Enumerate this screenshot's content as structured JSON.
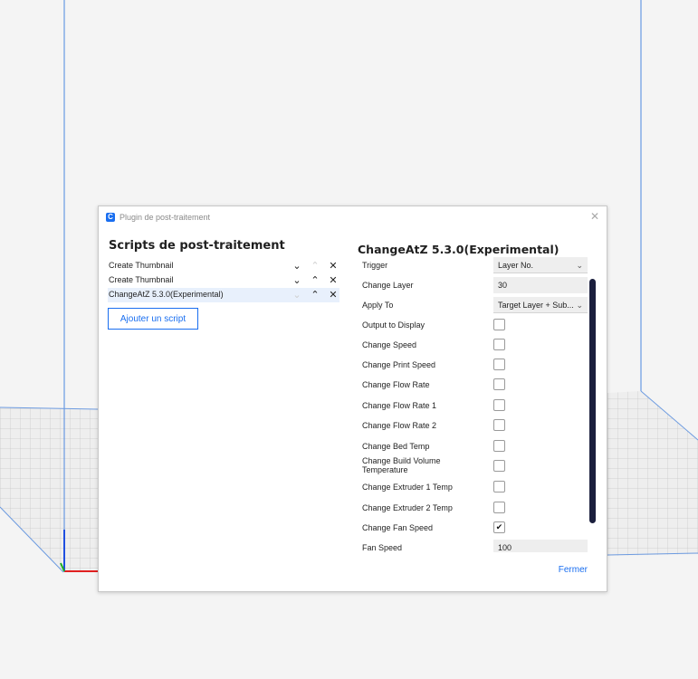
{
  "colors": {
    "accent": "#196ef0",
    "scrollbar": "#1b1f3d",
    "selected_row": "#e8f0fc"
  },
  "window": {
    "title": "Plugin de post-traitement",
    "icon": "app-icon",
    "icon_letter": "C",
    "close_icon": "close-icon"
  },
  "scripts_panel": {
    "heading": "Scripts de post-traitement",
    "items": [
      {
        "label": "Create Thumbnail",
        "selected": false
      },
      {
        "label": "Create Thumbnail",
        "selected": false
      },
      {
        "label": "ChangeAtZ 5.3.0(Experimental)",
        "selected": true
      }
    ],
    "add_label": "Ajouter un script"
  },
  "settings_panel": {
    "heading": "ChangeAtZ 5.3.0(Experimental)",
    "rows": [
      {
        "label": "Trigger",
        "type": "dropdown",
        "value": "Layer No."
      },
      {
        "label": "Change Layer",
        "type": "text",
        "value": "30"
      },
      {
        "label": "Apply To",
        "type": "dropdown",
        "value": "Target Layer + Sub..."
      },
      {
        "label": "Output to Display",
        "type": "checkbox",
        "checked": false
      },
      {
        "label": "Change Speed",
        "type": "checkbox",
        "checked": false
      },
      {
        "label": "Change Print Speed",
        "type": "checkbox",
        "checked": false
      },
      {
        "label": "Change Flow Rate",
        "type": "checkbox",
        "checked": false
      },
      {
        "label": "Change Flow Rate 1",
        "type": "checkbox",
        "checked": false
      },
      {
        "label": "Change Flow Rate 2",
        "type": "checkbox",
        "checked": false
      },
      {
        "label": "Change Bed Temp",
        "type": "checkbox",
        "checked": false
      },
      {
        "label": "Change Build Volume Temperature",
        "type": "checkbox",
        "checked": false
      },
      {
        "label": "Change Extruder 1 Temp",
        "type": "checkbox",
        "checked": false
      },
      {
        "label": "Change Extruder 2 Temp",
        "type": "checkbox",
        "checked": false
      },
      {
        "label": "Change Fan Speed",
        "type": "checkbox",
        "checked": true
      },
      {
        "label": "Fan Speed",
        "type": "text",
        "value": "100"
      }
    ]
  },
  "footer": {
    "close_label": "Fermer"
  }
}
